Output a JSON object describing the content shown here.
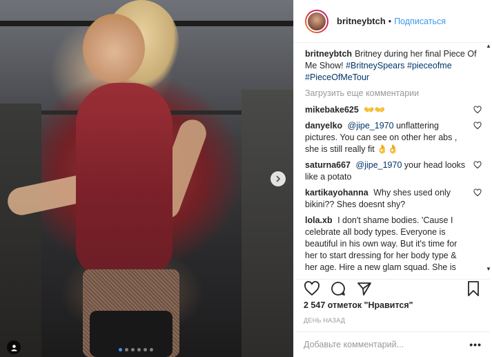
{
  "post": {
    "username": "britneybtch",
    "follow_label": "Подписаться",
    "separator": "•",
    "caption": {
      "username": "britneybtch",
      "text": "Britney during her final Piece Of Me Show!",
      "tags": [
        "#BritneySpears",
        "#pieceofme",
        "#PieceOfMeTour"
      ]
    },
    "load_more": "Загрузить еще комментарии",
    "comments": [
      {
        "username": "mikebake625",
        "text": "👐👐"
      },
      {
        "username": "danyelko",
        "mention": "@jipe_1970",
        "text": "unflattering pictures. You can see on other her abs , she is still really fit 👌👌"
      },
      {
        "username": "saturna667",
        "mention": "@jipe_1970",
        "text": "your head looks like a potato"
      },
      {
        "username": "kartikayohanna",
        "text": "Why shes used only bikini?? Shes doesnt shy?"
      },
      {
        "username": "lola.xb",
        "text": "I don't shame bodies. 'Cause I celebrate all body types. Everyone is beautiful in his own way. But it's time for her to start dressing for her body type & her age. Hire a new glam squad. She is"
      }
    ],
    "likes": "2 547 отметок \"Нравится\"",
    "date": "ДЕНЬ НАЗАД",
    "add_comment_placeholder": "Добавьте комментарий...",
    "more_label": "•••",
    "carousel": {
      "total": 6,
      "active": 1
    },
    "colors": {
      "link": "#3897f0",
      "hashtag": "#003569",
      "muted": "#999999"
    }
  }
}
